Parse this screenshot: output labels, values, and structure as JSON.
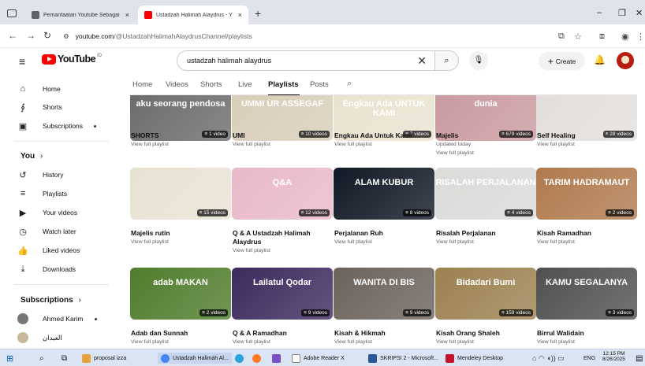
{
  "browser": {
    "tabs": [
      {
        "title": "Pemanfaatan Youtube Sebagai",
        "close": "×",
        "favicon_color": "#5f6368"
      },
      {
        "title": "Ustadzah Halimah Alaydrus - Y",
        "close": "×",
        "favicon_color": "#ff0000"
      }
    ],
    "new_tab": "+",
    "window_controls": {
      "minimize": "–",
      "maximize": "❐",
      "close": "✕"
    },
    "url_host": "youtube.com",
    "url_path": "/@UstadzahHalimahAlaydrusChannel/playlists"
  },
  "youtube": {
    "logo_text": "YouTube",
    "logo_sup": "ID",
    "search_value": "ustadzah halimah alaydrus",
    "create_label": "Create",
    "brand_color": "#ff0000"
  },
  "sidebar": {
    "items": [
      {
        "label": "Home",
        "icon": "home-icon",
        "glyph": "⌂"
      },
      {
        "label": "Shorts",
        "icon": "shorts-icon",
        "glyph": "∮"
      },
      {
        "label": "Subscriptions",
        "icon": "subscriptions-icon",
        "glyph": "▣"
      }
    ],
    "you_heading": "You",
    "you_items": [
      {
        "label": "History",
        "icon": "history-icon",
        "glyph": "↺"
      },
      {
        "label": "Playlists",
        "icon": "playlists-icon",
        "glyph": "≡"
      },
      {
        "label": "Your videos",
        "icon": "your-videos-icon",
        "glyph": "▶"
      },
      {
        "label": "Watch later",
        "icon": "watch-later-icon",
        "glyph": "◷"
      },
      {
        "label": "Liked videos",
        "icon": "liked-videos-icon",
        "glyph": "👍"
      },
      {
        "label": "Downloads",
        "icon": "downloads-icon",
        "glyph": "⤓"
      }
    ],
    "subscriptions_heading": "Subscriptions",
    "subscriptions": [
      {
        "label": "Ahmed Karim"
      },
      {
        "label": "العبدان"
      }
    ]
  },
  "channel_tabs": [
    "Home",
    "Videos",
    "Shorts",
    "Live",
    "Playlists",
    "Posts"
  ],
  "active_tab": "Playlists",
  "playlists": [
    {
      "title": "SHORTS",
      "sub": "View full playlist",
      "count": "1 video",
      "thumb_text": "aku seorang pendosa",
      "color": "#6b6b6b"
    },
    {
      "title": "UMI",
      "sub": "View full playlist",
      "count": "10 videos",
      "thumb_text": "UMMI UR ASSEGAF",
      "color": "#d8cdb8"
    },
    {
      "title": "Engkau Ada Untuk Kami",
      "sub": "View full playlist",
      "count": "7 videos",
      "thumb_text": "Engkau Ada UNTUK KAMI",
      "color": "#e9e2cf"
    },
    {
      "title": "Majelis",
      "sub": "Updated today",
      "sub2": "View full playlist",
      "count": "679 videos",
      "thumb_text": "dunia",
      "color": "#c99a9f"
    },
    {
      "title": "Self Healing",
      "sub": "View full playlist",
      "count": "28 videos",
      "thumb_text": "",
      "color": "#e2dedc"
    },
    {
      "title": "Majelis rutin",
      "sub": "View full playlist",
      "count": "15 videos",
      "thumb_text": "",
      "color": "#e8e2d2"
    },
    {
      "title": "Q & A Ustadzah Halimah Alaydrus",
      "sub": "View full playlist",
      "count": "12 videos",
      "thumb_text": "Q&A",
      "color": "#e9b9c8"
    },
    {
      "title": "Perjalanan Ruh",
      "sub": "View full playlist",
      "count": "8 videos",
      "thumb_text": "ALAM KUBUR",
      "color": "#101825"
    },
    {
      "title": "Risalah Perjalanan",
      "sub": "View full playlist",
      "count": "4 videos",
      "thumb_text": "RISALAH PERJALANAN",
      "color": "#d9dbd8"
    },
    {
      "title": "Kisah Ramadhan",
      "sub": "View full playlist",
      "count": "2 videos",
      "thumb_text": "TARIM HADRAMAUT",
      "color": "#b07a4e"
    },
    {
      "title": "Adab dan Sunnah",
      "sub": "View full playlist",
      "count": "2 videos",
      "thumb_text": "adab MAKAN",
      "color": "#4f7c2c"
    },
    {
      "title": "Q & A Ramadhan",
      "sub": "View full playlist",
      "count": "9 videos",
      "thumb_text": "Lailatul Qodar",
      "color": "#3b2a5d"
    },
    {
      "title": "Kisah & Hikmah",
      "sub": "View full playlist",
      "count": "9 videos",
      "thumb_text": "WANITA DI BIS",
      "color": "#6b625b"
    },
    {
      "title": "Kisah Orang Shaleh",
      "sub": "View full playlist",
      "count": "159 videos",
      "thumb_text": "Bidadari Bumi",
      "color": "#9c8150"
    },
    {
      "title": "Birrul Walidain",
      "sub": "View full playlist",
      "count": "3 videos",
      "thumb_text": "KAMU SEGALANYA",
      "color": "#505050"
    }
  ],
  "taskbar": {
    "items": [
      {
        "label": "proposal izza",
        "color": "#e6a23c"
      },
      {
        "label": "Ustadzah Halimah Al...",
        "color": "#4285f4"
      },
      {
        "label": "Adobe Reader X",
        "color": "#ffffff"
      },
      {
        "label": "SKRIPSI 2 - Microsoft...",
        "color": "#2b579a"
      },
      {
        "label": "Mendeley Desktop",
        "color": "#c4122f"
      }
    ],
    "lang": "ENG",
    "time": "12:15 PM",
    "date": "8/26/2025"
  }
}
